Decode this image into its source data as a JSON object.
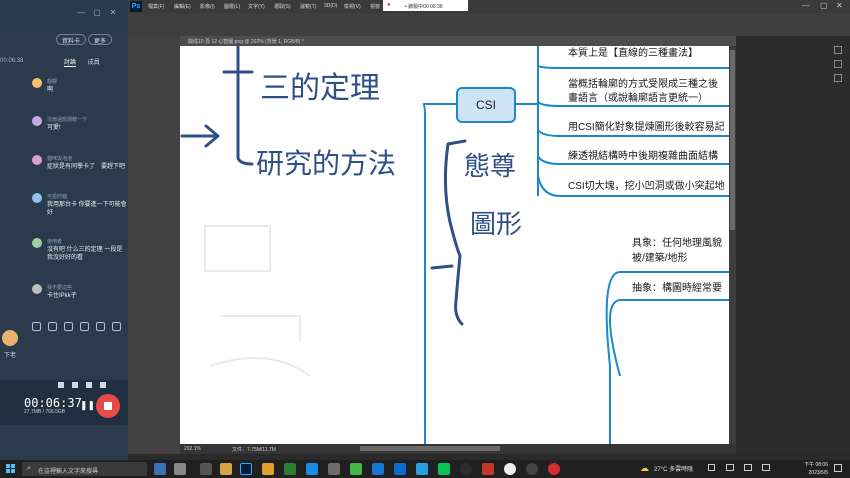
{
  "left_panel": {
    "buttons": [
      "資料卡",
      "更多"
    ],
    "elapsed_label": "00:06:38",
    "tabs": [
      "討論",
      "成員"
    ],
    "messages": [
      {
        "user": "靜靜",
        "text": "啊"
      },
      {
        "user": "沈雨涵想請教一下",
        "text": "可愛!"
      },
      {
        "user": "貓咪與泡泡",
        "text": "症狀是有同學卡了　要趕下吧"
      },
      {
        "user": "可愛的貓",
        "text": "我用那台卡 你要進一下可能會好"
      },
      {
        "user": "使用者",
        "text": "沒有吧 什么三的定理 一段是我沒好好的看"
      },
      {
        "user": "我不要這些",
        "text": "卡住IPkk子"
      }
    ],
    "host_label": "下老",
    "record_time": "00:06:37",
    "record_size": "27.7MB / 766.5GB"
  },
  "photoshop": {
    "logo": "Ps",
    "menu": [
      "檔案(F)",
      "編輯(E)",
      "影像(I)",
      "圖層(L)",
      "文字(Y)",
      "選取(S)",
      "濾鏡(T)",
      "3D(D)",
      "檢視(V)",
      "視窗"
    ],
    "recording_pill": "• 錄製中00:06:38",
    "doc_tab": "開成10 頁 12 心智圖.png @ 202% (背景 1, RGB/8) *",
    "zoom_status": "202.1%",
    "file_status": "文件：7.75M/11.7M"
  },
  "canvas": {
    "handwriting": [
      "三的定理",
      "研究的方法",
      "態尊",
      "圖形"
    ],
    "csi_node": "CSI",
    "branches": [
      "本質上是【直線的三種畫法】",
      "當概括輪廓的方式受限成三種之後",
      "畫語言（或說輪廓語言更統一）",
      "用CSI簡化對象提煉圖形後較容易記",
      "練透視結構時中後期複雜曲面結構",
      "CSI切大塊，挖小凹洞或做小突起地"
    ],
    "lower_branches": [
      "具象：任何地理風貌",
      "被/建築/地形",
      "抽象：構圖時經常要"
    ],
    "colors": {
      "line": "#1b89c9",
      "csi_fill": "#cde4f7",
      "csi_border": "#1b89c9",
      "ink": "#2f4f86"
    }
  },
  "taskbar": {
    "search_placeholder": "在這裡輸入文字來搜尋",
    "weather": "27°C 多雲時陰",
    "time": "下午 08:06",
    "date": "2023/5/5"
  }
}
